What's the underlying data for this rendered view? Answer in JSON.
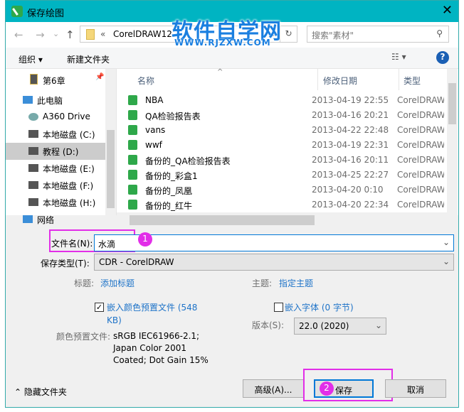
{
  "window": {
    "title": "保存绘图"
  },
  "nav": {
    "back": "←",
    "forward": "→",
    "recent": "⌄",
    "up": "↑",
    "chevron": "«",
    "path": "CorelDRAW12",
    "refresh": "↻",
    "search_placeholder": "搜索\"素材\""
  },
  "toolbar": {
    "organize": "组织",
    "new_folder": "新建文件夹",
    "help": "?"
  },
  "sidebar": {
    "items": [
      {
        "label": "第6章",
        "icon": "folder-icon"
      },
      {
        "label": "此电脑",
        "icon": "computer-icon"
      },
      {
        "label": "A360 Drive",
        "icon": "cloud-drive-icon"
      },
      {
        "label": "本地磁盘 (C:)",
        "icon": "drive-icon"
      },
      {
        "label": "教程 (D:)",
        "icon": "drive-icon",
        "selected": true
      },
      {
        "label": "本地磁盘 (E:)",
        "icon": "drive-icon"
      },
      {
        "label": "本地磁盘 (F:)",
        "icon": "drive-icon"
      },
      {
        "label": "本地磁盘 (H:)",
        "icon": "drive-icon"
      },
      {
        "label": "网络",
        "icon": "network-icon"
      }
    ]
  },
  "columns": {
    "name": "名称",
    "date": "修改日期",
    "type": "类型"
  },
  "files": [
    {
      "name": "NBA",
      "date": "2013-04-19 22:55",
      "type": "CorelDRAW"
    },
    {
      "name": "QA检验报告表",
      "date": "2013-04-16 20:21",
      "type": "CorelDRAW"
    },
    {
      "name": "vans",
      "date": "2013-04-22 22:48",
      "type": "CorelDRAW"
    },
    {
      "name": "wwf",
      "date": "2013-04-19 22:31",
      "type": "CorelDRAW"
    },
    {
      "name": "备份的_QA检验报告表",
      "date": "2013-04-16 20:11",
      "type": "CorelDRAW"
    },
    {
      "name": "备份的_彩盒1",
      "date": "2013-04-25 22:27",
      "type": "CorelDRAW"
    },
    {
      "name": "备份的_凤凰",
      "date": "2013-04-20 0:10",
      "type": "CorelDRAW"
    },
    {
      "name": "备份的_红牛",
      "date": "2013-04-20 22:34",
      "type": "CorelDRAW"
    }
  ],
  "form": {
    "filename_label": "文件名(N):",
    "filename_value": "水滴",
    "filetype_label": "保存类型(T):",
    "filetype_value": "CDR - CorelDRAW",
    "title_label": "标题:",
    "title_link": "添加标题",
    "subject_label": "主题:",
    "subject_link": "指定主题",
    "embed_color_label": "嵌入颜色预置文件 (548 KB)",
    "embed_color_checked": true,
    "embed_font_label": "嵌入字体 (0 字节)",
    "embed_font_checked": false,
    "version_label": "版本(S):",
    "version_value": "22.0 (2020)",
    "color_profile_label": "颜色预置文件:",
    "color_profile_lines": [
      "sRGB IEC61966-2.1;",
      "Japan Color 2001",
      "Coated; Dot Gain 15%"
    ]
  },
  "footer": {
    "hide_folders": "隐藏文件夹",
    "advanced": "高级(A)...",
    "save": "保存",
    "cancel": "取消"
  },
  "annotations": {
    "badge1": "1",
    "badge2": "2",
    "color": "#e22ee8"
  },
  "watermark": {
    "text": "软件自学网",
    "url": "WWW.RJZXW.COM"
  }
}
